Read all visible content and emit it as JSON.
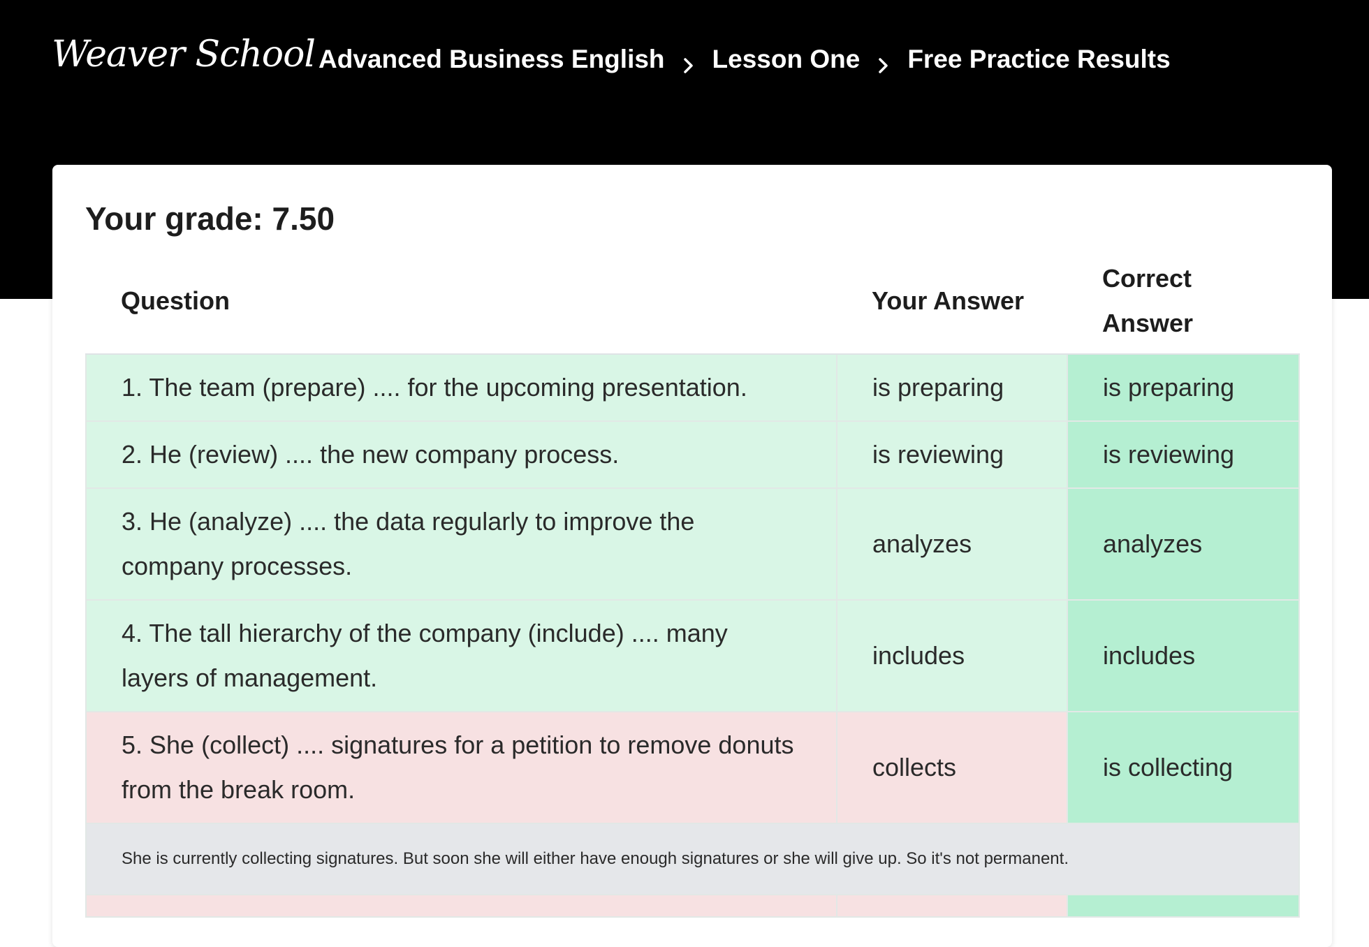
{
  "brand": {
    "logo_text": "Weaver School"
  },
  "breadcrumb": {
    "items": [
      "Advanced Business English",
      "Lesson One",
      "Free Practice Results"
    ]
  },
  "results": {
    "grade_text": "Your grade: 7.50",
    "headers": {
      "question": "Question",
      "your_answer": "Your Answer",
      "correct_answer_line1": "Correct",
      "correct_answer_line2": "Answer"
    },
    "rows": [
      {
        "question": "1. The team (prepare) .... for the upcoming presentation.",
        "your_answer": "is preparing",
        "correct_answer": "is preparing",
        "status": "correct"
      },
      {
        "question": "2. He (review) .... the new company process.",
        "your_answer": "is reviewing",
        "correct_answer": "is reviewing",
        "status": "correct"
      },
      {
        "question": "3. He (analyze) .... the data regularly to improve the company processes.",
        "your_answer": "analyzes",
        "correct_answer": "analyzes",
        "status": "correct"
      },
      {
        "question": "4. The tall hierarchy of the company (include) .... many layers of management.",
        "your_answer": "includes",
        "correct_answer": "includes",
        "status": "correct"
      },
      {
        "question": "5. She (collect) .... signatures for a petition to remove donuts from the break room.",
        "your_answer": "collects",
        "correct_answer": "is collecting",
        "status": "incorrect"
      }
    ],
    "explanation": "She is currently collecting signatures. But soon she will either have enough signatures or she will give up. So it's not permanent."
  },
  "colors": {
    "header_bg": "#000000",
    "correct_row": "#d9f6e6",
    "incorrect_row": "#f7e1e2",
    "correct_answer_cell": "#b5efd2",
    "explanation_row": "#e5e7ea"
  }
}
